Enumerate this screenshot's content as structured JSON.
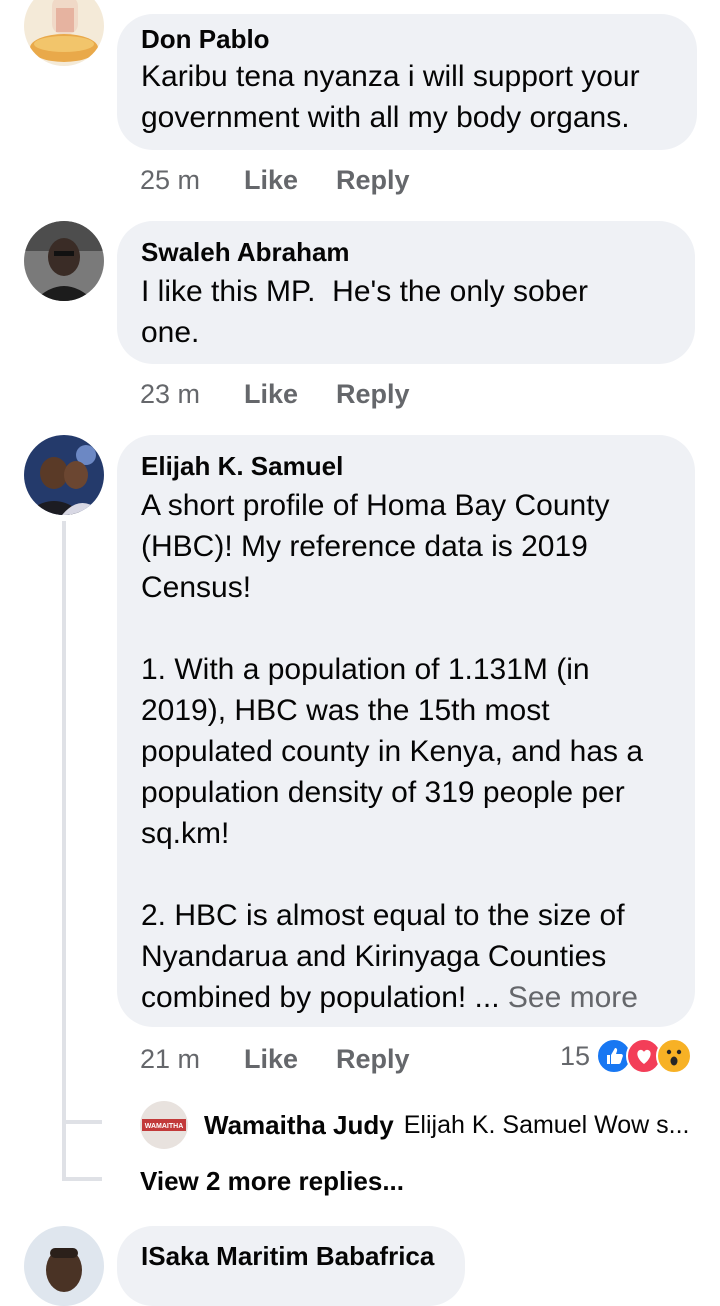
{
  "comments": [
    {
      "name": "Don Pablo",
      "text": "Karibu tena nyanza i will support your\ngovernment with all my body organs.",
      "time": "25 m",
      "like": "Like",
      "reply": "Reply"
    },
    {
      "name": "Swaleh Abraham",
      "text": "I like this MP.  He's the only sober\none.",
      "time": "23 m",
      "like": "Like",
      "reply": "Reply"
    },
    {
      "name": "Elijah K. Samuel",
      "text": "A short profile of Homa Bay County\n(HBC)! My reference data is 2019\nCensus!\n\n1. With a population of 1.131M (in\n2019), HBC was the 15th most\npopulated county in Kenya, and has a\npopulation density of 319 people per\nsq.km!\n\n2. HBC is almost equal to the size of\nNyandarua and Kirinyaga Counties\ncombined by population! ... ",
      "see_more": "See more",
      "time": "21 m",
      "like": "Like",
      "reply": "Reply",
      "reaction_count": "15",
      "reactions": [
        "like-reaction-icon",
        "love-reaction-icon",
        "wow-reaction-icon"
      ]
    },
    {
      "name": "ISaka Maritim Babafrica"
    }
  ],
  "reply_preview": {
    "name": "Wamaitha Judy",
    "text": "Elijah K. Samuel Wow s...",
    "avatar_text": "WAMAITHA"
  },
  "view_more_replies": "View 2 more replies...",
  "colors": {
    "bubble": "#eff1f5",
    "meta": "#65676b",
    "like_blue": "#1877f2",
    "love_red": "#f33e58",
    "wow_yellow": "#f7b125"
  }
}
